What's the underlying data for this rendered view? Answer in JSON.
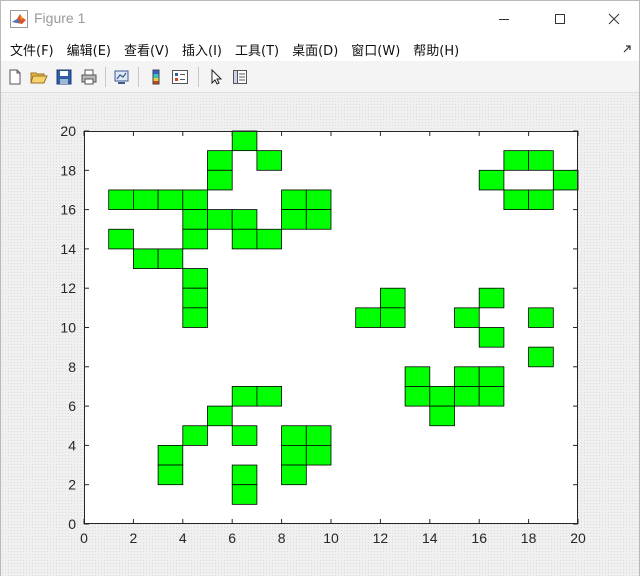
{
  "window": {
    "title": "Figure 1"
  },
  "menu": [
    "文件(F)",
    "编辑(E)",
    "查看(V)",
    "插入(I)",
    "工具(T)",
    "桌面(D)",
    "窗口(W)",
    "帮助(H)"
  ],
  "toolbar": [
    "new-figure-icon",
    "open-file-icon",
    "save-icon",
    "print-icon",
    "link-plot-icon",
    "colorbar-icon",
    "legend-icon",
    "edit-plot-cursor-icon",
    "property-inspector-icon"
  ],
  "colors": {
    "cell_fill": "#00ff00",
    "cell_edge": "#000000",
    "axes_bg": "#ffffff"
  },
  "chart_data": {
    "type": "grid-cells",
    "xlim": [
      0,
      20
    ],
    "ylim": [
      0,
      20
    ],
    "xticks": [
      "0",
      "2",
      "4",
      "6",
      "8",
      "10",
      "12",
      "14",
      "16",
      "18",
      "20"
    ],
    "yticks": [
      "0",
      "2",
      "4",
      "6",
      "8",
      "10",
      "12",
      "14",
      "16",
      "18",
      "20"
    ],
    "cell_size": 1,
    "cells": [
      [
        6,
        19
      ],
      [
        5,
        18
      ],
      [
        7,
        18
      ],
      [
        17,
        18
      ],
      [
        18,
        18
      ],
      [
        5,
        17
      ],
      [
        16,
        17
      ],
      [
        19,
        17
      ],
      [
        1,
        16
      ],
      [
        2,
        16
      ],
      [
        3,
        16
      ],
      [
        4,
        16
      ],
      [
        8,
        16
      ],
      [
        9,
        16
      ],
      [
        17,
        16
      ],
      [
        18,
        16
      ],
      [
        4,
        15
      ],
      [
        5,
        15
      ],
      [
        6,
        15
      ],
      [
        8,
        15
      ],
      [
        9,
        15
      ],
      [
        1,
        14
      ],
      [
        4,
        14
      ],
      [
        6,
        14
      ],
      [
        7,
        14
      ],
      [
        2,
        13
      ],
      [
        3,
        13
      ],
      [
        4,
        12
      ],
      [
        4,
        11
      ],
      [
        12,
        11
      ],
      [
        16,
        11
      ],
      [
        4,
        10
      ],
      [
        11,
        10
      ],
      [
        12,
        10
      ],
      [
        15,
        10
      ],
      [
        18,
        10
      ],
      [
        16,
        9
      ],
      [
        18,
        8
      ],
      [
        13,
        7
      ],
      [
        15,
        7
      ],
      [
        16,
        7
      ],
      [
        6,
        6
      ],
      [
        7,
        6
      ],
      [
        13,
        6
      ],
      [
        14,
        6
      ],
      [
        15,
        6
      ],
      [
        16,
        6
      ],
      [
        5,
        5
      ],
      [
        14,
        5
      ],
      [
        4,
        4
      ],
      [
        6,
        4
      ],
      [
        8,
        4
      ],
      [
        9,
        4
      ],
      [
        3,
        3
      ],
      [
        8,
        3
      ],
      [
        9,
        3
      ],
      [
        3,
        2
      ],
      [
        6,
        2
      ],
      [
        8,
        2
      ],
      [
        6,
        1
      ]
    ]
  }
}
